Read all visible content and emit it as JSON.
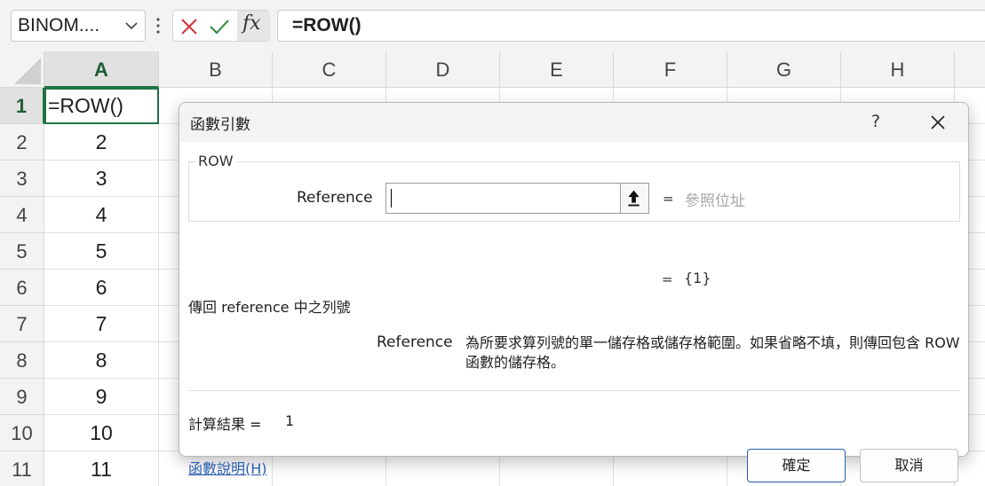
{
  "formula_bar": {
    "name_box": "BINOM....",
    "formula": "=ROW()",
    "fx_label": "fx"
  },
  "grid": {
    "columns": [
      "A",
      "B",
      "C",
      "D",
      "E",
      "F",
      "G",
      "H"
    ],
    "active_column": "A",
    "active_row": "1",
    "rows": [
      {
        "num": "1",
        "a": "=ROW()"
      },
      {
        "num": "2",
        "a": "2"
      },
      {
        "num": "3",
        "a": "3"
      },
      {
        "num": "4",
        "a": "4"
      },
      {
        "num": "5",
        "a": "5"
      },
      {
        "num": "6",
        "a": "6"
      },
      {
        "num": "7",
        "a": "7"
      },
      {
        "num": "8",
        "a": "8"
      },
      {
        "num": "9",
        "a": "9"
      },
      {
        "num": "10",
        "a": "10"
      },
      {
        "num": "11",
        "a": "11"
      }
    ]
  },
  "dialog": {
    "title": "函數引數",
    "help_label": "?",
    "function_name": "ROW",
    "argument": {
      "label": "Reference",
      "value": "",
      "equals": "=",
      "hint": "參照位址"
    },
    "result_preview": {
      "equals": "=",
      "value": "{1}"
    },
    "function_description": "傳回 reference 中之列號",
    "argument_description": {
      "label": "Reference",
      "text": "為所要求算列號的單一儲存格或儲存格範圍。如果省略不填，則傳回包含 ROW 函數的儲存格。"
    },
    "calc_result": {
      "label": "計算結果 =",
      "value": "1"
    },
    "help_link": "函數說明(H)",
    "ok_button": "確定",
    "cancel_button": "取消"
  }
}
